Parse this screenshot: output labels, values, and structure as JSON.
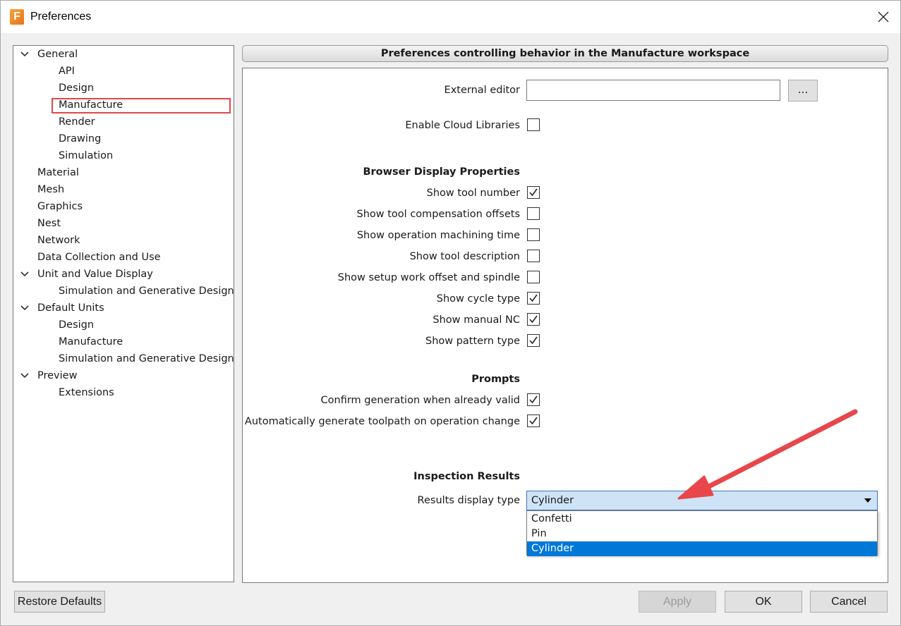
{
  "window": {
    "title": "Preferences",
    "app_icon_letter": "F"
  },
  "tree": [
    {
      "label": "General",
      "level": 0,
      "expanded": true
    },
    {
      "label": "API",
      "level": 1
    },
    {
      "label": "Design",
      "level": 1
    },
    {
      "label": "Manufacture",
      "level": 1,
      "selected": true
    },
    {
      "label": "Render",
      "level": 1
    },
    {
      "label": "Drawing",
      "level": 1
    },
    {
      "label": "Simulation",
      "level": 1
    },
    {
      "label": "Material",
      "level": 0
    },
    {
      "label": "Mesh",
      "level": 0
    },
    {
      "label": "Graphics",
      "level": 0
    },
    {
      "label": "Nest",
      "level": 0
    },
    {
      "label": "Network",
      "level": 0
    },
    {
      "label": "Data Collection and Use",
      "level": 0
    },
    {
      "label": "Unit and Value Display",
      "level": 0,
      "expanded": true
    },
    {
      "label": "Simulation and Generative Design",
      "level": 1
    },
    {
      "label": "Default Units",
      "level": 0,
      "expanded": true
    },
    {
      "label": "Design",
      "level": 1
    },
    {
      "label": "Manufacture",
      "level": 1
    },
    {
      "label": "Simulation and Generative Design",
      "level": 1
    },
    {
      "label": "Preview",
      "level": 0,
      "expanded": true
    },
    {
      "label": "Extensions",
      "level": 1
    }
  ],
  "panel": {
    "header": "Preferences controlling behavior in the Manufacture workspace",
    "external_editor_label": "External editor",
    "external_editor_value": "",
    "browse_label": "...",
    "enable_cloud_label": "Enable Cloud Libraries",
    "enable_cloud_checked": false,
    "browser_section": "Browser Display Properties",
    "browser_options": [
      {
        "label": "Show tool number",
        "checked": true
      },
      {
        "label": "Show tool compensation offsets",
        "checked": false
      },
      {
        "label": "Show operation machining time",
        "checked": false
      },
      {
        "label": "Show tool description",
        "checked": false
      },
      {
        "label": "Show setup work offset and spindle",
        "checked": false
      },
      {
        "label": "Show cycle type",
        "checked": true
      },
      {
        "label": "Show manual NC",
        "checked": true
      },
      {
        "label": "Show pattern type",
        "checked": true
      }
    ],
    "prompts_section": "Prompts",
    "prompt_options": [
      {
        "label": "Confirm generation when already valid",
        "checked": true
      },
      {
        "label": "Automatically generate toolpath on operation change",
        "checked": true
      }
    ],
    "inspection_section": "Inspection Results",
    "results_label": "Results display type",
    "results_value": "Cylinder",
    "results_options": [
      "Confetti",
      "Pin",
      "Cylinder"
    ]
  },
  "footer": {
    "restore": "Restore Defaults",
    "apply": "Apply",
    "ok": "OK",
    "cancel": "Cancel"
  },
  "colors": {
    "selection_outline": "#e04848",
    "annotation_arrow": "#e8464a",
    "dropdown_highlight": "#0078d7"
  }
}
